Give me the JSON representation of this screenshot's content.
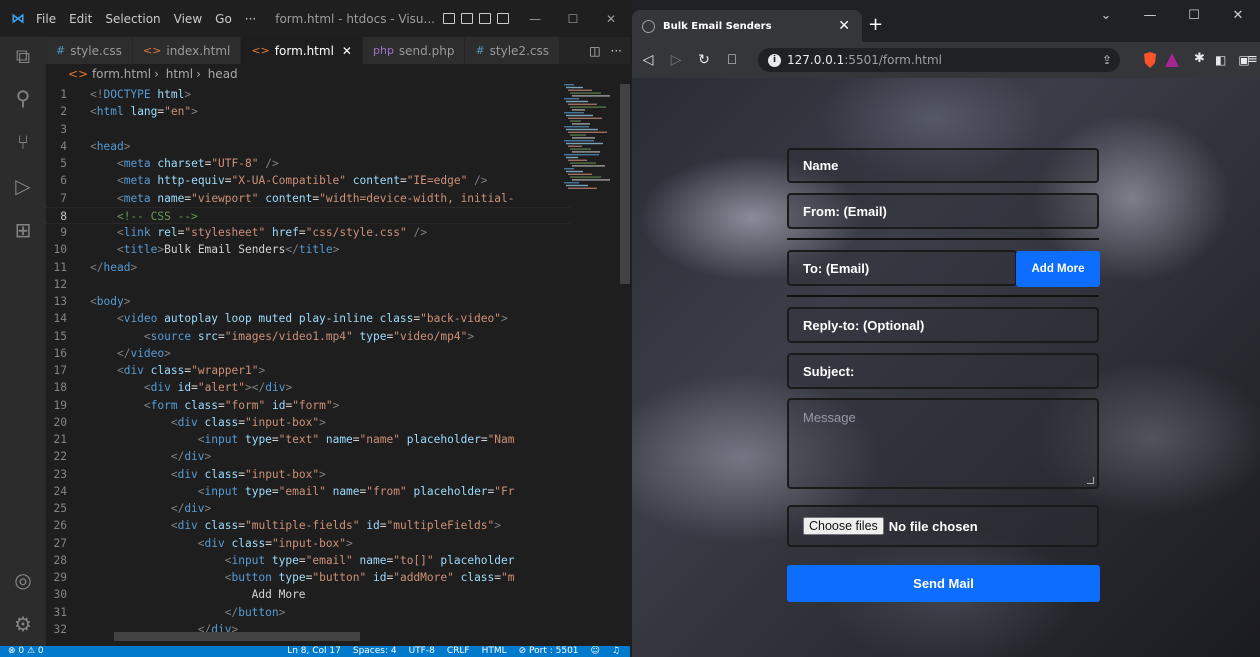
{
  "vscode": {
    "menu": [
      "File",
      "Edit",
      "Selection",
      "View",
      "Go",
      "···"
    ],
    "window_title": "form.html - htdocs - Visu...",
    "tabs": [
      {
        "label": "style.css",
        "icon": "#",
        "color": "#519aba"
      },
      {
        "label": "index.html",
        "icon": "<>",
        "color": "#e37933"
      },
      {
        "label": "form.html",
        "icon": "<>",
        "color": "#e37933",
        "active": true
      },
      {
        "label": "send.php",
        "icon": "php",
        "color": "#a074c4"
      },
      {
        "label": "style2.css",
        "icon": "#",
        "color": "#519aba"
      }
    ],
    "breadcrumb": [
      "form.html",
      "html",
      "head"
    ],
    "current_line": 8,
    "lines": [
      {
        "n": 1,
        "t": [
          [
            "punc",
            "<!"
          ],
          [
            "tag",
            "DOCTYPE"
          ],
          [
            "txt",
            " "
          ],
          [
            "attr",
            "html"
          ],
          [
            "punc",
            ">"
          ]
        ]
      },
      {
        "n": 2,
        "t": [
          [
            "punc",
            "<"
          ],
          [
            "tag",
            "html"
          ],
          [
            "txt",
            " "
          ],
          [
            "attr",
            "lang"
          ],
          [
            "txt",
            "="
          ],
          [
            "str",
            "\"en\""
          ],
          [
            "punc",
            ">"
          ]
        ]
      },
      {
        "n": 3,
        "t": []
      },
      {
        "n": 4,
        "t": [
          [
            "punc",
            "<"
          ],
          [
            "tag",
            "head"
          ],
          [
            "punc",
            ">"
          ]
        ]
      },
      {
        "n": 5,
        "t": [
          [
            "txt",
            "    "
          ],
          [
            "punc",
            "<"
          ],
          [
            "tag",
            "meta"
          ],
          [
            "txt",
            " "
          ],
          [
            "attr",
            "charset"
          ],
          [
            "txt",
            "="
          ],
          [
            "str",
            "\"UTF-8\""
          ],
          [
            "txt",
            " "
          ],
          [
            "punc",
            "/>"
          ]
        ]
      },
      {
        "n": 6,
        "t": [
          [
            "txt",
            "    "
          ],
          [
            "punc",
            "<"
          ],
          [
            "tag",
            "meta"
          ],
          [
            "txt",
            " "
          ],
          [
            "attr",
            "http-equiv"
          ],
          [
            "txt",
            "="
          ],
          [
            "str",
            "\"X-UA-Compatible\""
          ],
          [
            "txt",
            " "
          ],
          [
            "attr",
            "content"
          ],
          [
            "txt",
            "="
          ],
          [
            "str",
            "\"IE=edge\""
          ],
          [
            "txt",
            " "
          ],
          [
            "punc",
            "/>"
          ]
        ]
      },
      {
        "n": 7,
        "t": [
          [
            "txt",
            "    "
          ],
          [
            "punc",
            "<"
          ],
          [
            "tag",
            "meta"
          ],
          [
            "txt",
            " "
          ],
          [
            "attr",
            "name"
          ],
          [
            "txt",
            "="
          ],
          [
            "str",
            "\"viewport\""
          ],
          [
            "txt",
            " "
          ],
          [
            "attr",
            "content"
          ],
          [
            "txt",
            "="
          ],
          [
            "str",
            "\"width=device-width, initial-"
          ]
        ]
      },
      {
        "n": 8,
        "t": [
          [
            "txt",
            "    "
          ],
          [
            "cmt",
            "<!-- CSS -->"
          ]
        ]
      },
      {
        "n": 9,
        "t": [
          [
            "txt",
            "    "
          ],
          [
            "punc",
            "<"
          ],
          [
            "tag",
            "link"
          ],
          [
            "txt",
            " "
          ],
          [
            "attr",
            "rel"
          ],
          [
            "txt",
            "="
          ],
          [
            "str",
            "\"stylesheet\""
          ],
          [
            "txt",
            " "
          ],
          [
            "attr",
            "href"
          ],
          [
            "txt",
            "="
          ],
          [
            "str",
            "\"css/style.css\""
          ],
          [
            "txt",
            " "
          ],
          [
            "punc",
            "/>"
          ]
        ]
      },
      {
        "n": 10,
        "t": [
          [
            "txt",
            "    "
          ],
          [
            "punc",
            "<"
          ],
          [
            "tag",
            "title"
          ],
          [
            "punc",
            ">"
          ],
          [
            "txt",
            "Bulk Email Senders"
          ],
          [
            "punc",
            "</"
          ],
          [
            "tag",
            "title"
          ],
          [
            "punc",
            ">"
          ]
        ]
      },
      {
        "n": 11,
        "t": [
          [
            "punc",
            "</"
          ],
          [
            "tag",
            "head"
          ],
          [
            "punc",
            ">"
          ]
        ]
      },
      {
        "n": 12,
        "t": []
      },
      {
        "n": 13,
        "t": [
          [
            "punc",
            "<"
          ],
          [
            "tag",
            "body"
          ],
          [
            "punc",
            ">"
          ]
        ]
      },
      {
        "n": 14,
        "t": [
          [
            "txt",
            "    "
          ],
          [
            "punc",
            "<"
          ],
          [
            "tag",
            "video"
          ],
          [
            "txt",
            " "
          ],
          [
            "attr",
            "autoplay loop muted play-inline class"
          ],
          [
            "txt",
            "="
          ],
          [
            "str",
            "\"back-video\""
          ],
          [
            "punc",
            ">"
          ]
        ]
      },
      {
        "n": 15,
        "t": [
          [
            "txt",
            "        "
          ],
          [
            "punc",
            "<"
          ],
          [
            "tag",
            "source"
          ],
          [
            "txt",
            " "
          ],
          [
            "attr",
            "src"
          ],
          [
            "txt",
            "="
          ],
          [
            "str",
            "\"images/video1.mp4\""
          ],
          [
            "txt",
            " "
          ],
          [
            "attr",
            "type"
          ],
          [
            "txt",
            "="
          ],
          [
            "str",
            "\"video/mp4\""
          ],
          [
            "punc",
            ">"
          ]
        ]
      },
      {
        "n": 16,
        "t": [
          [
            "txt",
            "    "
          ],
          [
            "punc",
            "</"
          ],
          [
            "tag",
            "video"
          ],
          [
            "punc",
            ">"
          ]
        ]
      },
      {
        "n": 17,
        "t": [
          [
            "txt",
            "    "
          ],
          [
            "punc",
            "<"
          ],
          [
            "tag",
            "div"
          ],
          [
            "txt",
            " "
          ],
          [
            "attr",
            "class"
          ],
          [
            "txt",
            "="
          ],
          [
            "str",
            "\"wrapper1\""
          ],
          [
            "punc",
            ">"
          ]
        ]
      },
      {
        "n": 18,
        "t": [
          [
            "txt",
            "        "
          ],
          [
            "punc",
            "<"
          ],
          [
            "tag",
            "div"
          ],
          [
            "txt",
            " "
          ],
          [
            "attr",
            "id"
          ],
          [
            "txt",
            "="
          ],
          [
            "str",
            "\"alert\""
          ],
          [
            "punc",
            "></"
          ],
          [
            "tag",
            "div"
          ],
          [
            "punc",
            ">"
          ]
        ]
      },
      {
        "n": 19,
        "t": [
          [
            "txt",
            "        "
          ],
          [
            "punc",
            "<"
          ],
          [
            "tag",
            "form"
          ],
          [
            "txt",
            " "
          ],
          [
            "attr",
            "class"
          ],
          [
            "txt",
            "="
          ],
          [
            "str",
            "\"form\""
          ],
          [
            "txt",
            " "
          ],
          [
            "attr",
            "id"
          ],
          [
            "txt",
            "="
          ],
          [
            "str",
            "\"form\""
          ],
          [
            "punc",
            ">"
          ]
        ]
      },
      {
        "n": 20,
        "t": [
          [
            "txt",
            "            "
          ],
          [
            "punc",
            "<"
          ],
          [
            "tag",
            "div"
          ],
          [
            "txt",
            " "
          ],
          [
            "attr",
            "class"
          ],
          [
            "txt",
            "="
          ],
          [
            "str",
            "\"input-box\""
          ],
          [
            "punc",
            ">"
          ]
        ]
      },
      {
        "n": 21,
        "t": [
          [
            "txt",
            "                "
          ],
          [
            "punc",
            "<"
          ],
          [
            "tag",
            "input"
          ],
          [
            "txt",
            " "
          ],
          [
            "attr",
            "type"
          ],
          [
            "txt",
            "="
          ],
          [
            "str",
            "\"text\""
          ],
          [
            "txt",
            " "
          ],
          [
            "attr",
            "name"
          ],
          [
            "txt",
            "="
          ],
          [
            "str",
            "\"name\""
          ],
          [
            "txt",
            " "
          ],
          [
            "attr",
            "placeholder"
          ],
          [
            "txt",
            "="
          ],
          [
            "str",
            "\"Nam"
          ]
        ]
      },
      {
        "n": 22,
        "t": [
          [
            "txt",
            "            "
          ],
          [
            "punc",
            "</"
          ],
          [
            "tag",
            "div"
          ],
          [
            "punc",
            ">"
          ]
        ]
      },
      {
        "n": 23,
        "t": [
          [
            "txt",
            "            "
          ],
          [
            "punc",
            "<"
          ],
          [
            "tag",
            "div"
          ],
          [
            "txt",
            " "
          ],
          [
            "attr",
            "class"
          ],
          [
            "txt",
            "="
          ],
          [
            "str",
            "\"input-box\""
          ],
          [
            "punc",
            ">"
          ]
        ]
      },
      {
        "n": 24,
        "t": [
          [
            "txt",
            "                "
          ],
          [
            "punc",
            "<"
          ],
          [
            "tag",
            "input"
          ],
          [
            "txt",
            " "
          ],
          [
            "attr",
            "type"
          ],
          [
            "txt",
            "="
          ],
          [
            "str",
            "\"email\""
          ],
          [
            "txt",
            " "
          ],
          [
            "attr",
            "name"
          ],
          [
            "txt",
            "="
          ],
          [
            "str",
            "\"from\""
          ],
          [
            "txt",
            " "
          ],
          [
            "attr",
            "placeholder"
          ],
          [
            "txt",
            "="
          ],
          [
            "str",
            "\"Fr"
          ]
        ]
      },
      {
        "n": 25,
        "t": [
          [
            "txt",
            "            "
          ],
          [
            "punc",
            "</"
          ],
          [
            "tag",
            "div"
          ],
          [
            "punc",
            ">"
          ]
        ]
      },
      {
        "n": 26,
        "t": [
          [
            "txt",
            "            "
          ],
          [
            "punc",
            "<"
          ],
          [
            "tag",
            "div"
          ],
          [
            "txt",
            " "
          ],
          [
            "attr",
            "class"
          ],
          [
            "txt",
            "="
          ],
          [
            "str",
            "\"multiple-fields\""
          ],
          [
            "txt",
            " "
          ],
          [
            "attr",
            "id"
          ],
          [
            "txt",
            "="
          ],
          [
            "str",
            "\"multipleFields\""
          ],
          [
            "punc",
            ">"
          ]
        ]
      },
      {
        "n": 27,
        "t": [
          [
            "txt",
            "                "
          ],
          [
            "punc",
            "<"
          ],
          [
            "tag",
            "div"
          ],
          [
            "txt",
            " "
          ],
          [
            "attr",
            "class"
          ],
          [
            "txt",
            "="
          ],
          [
            "str",
            "\"input-box\""
          ],
          [
            "punc",
            ">"
          ]
        ]
      },
      {
        "n": 28,
        "t": [
          [
            "txt",
            "                    "
          ],
          [
            "punc",
            "<"
          ],
          [
            "tag",
            "input"
          ],
          [
            "txt",
            " "
          ],
          [
            "attr",
            "type"
          ],
          [
            "txt",
            "="
          ],
          [
            "str",
            "\"email\""
          ],
          [
            "txt",
            " "
          ],
          [
            "attr",
            "name"
          ],
          [
            "txt",
            "="
          ],
          [
            "str",
            "\"to[]\""
          ],
          [
            "txt",
            " "
          ],
          [
            "attr",
            "placeholder"
          ]
        ]
      },
      {
        "n": 29,
        "t": [
          [
            "txt",
            "                    "
          ],
          [
            "punc",
            "<"
          ],
          [
            "tag",
            "button"
          ],
          [
            "txt",
            " "
          ],
          [
            "attr",
            "type"
          ],
          [
            "txt",
            "="
          ],
          [
            "str",
            "\"button\""
          ],
          [
            "txt",
            " "
          ],
          [
            "attr",
            "id"
          ],
          [
            "txt",
            "="
          ],
          [
            "str",
            "\"addMore\""
          ],
          [
            "txt",
            " "
          ],
          [
            "attr",
            "class"
          ],
          [
            "txt",
            "="
          ],
          [
            "str",
            "\"m"
          ]
        ]
      },
      {
        "n": 30,
        "t": [
          [
            "txt",
            "                        Add More"
          ]
        ]
      },
      {
        "n": 31,
        "t": [
          [
            "txt",
            "                    "
          ],
          [
            "punc",
            "</"
          ],
          [
            "tag",
            "button"
          ],
          [
            "punc",
            ">"
          ]
        ]
      },
      {
        "n": 32,
        "t": [
          [
            "txt",
            "                "
          ],
          [
            "punc",
            "</"
          ],
          [
            "tag",
            "div"
          ],
          [
            "punc",
            ">"
          ]
        ]
      }
    ],
    "status_left": "⊗ 0  ⚠ 0",
    "status_right": [
      "Ln 8, Col 17",
      "Spaces: 4",
      "UTF-8",
      "CRLF",
      "HTML",
      "⊘ Port : 5501"
    ]
  },
  "browser": {
    "tab_title": "Bulk Email Senders",
    "url_host": "127.0.0.1",
    "url_path": ":5501/form.html",
    "form": {
      "name": "Name",
      "from": "From: (Email)",
      "to": "To: (Email)",
      "add_more": "Add More",
      "reply_to": "Reply-to: (Optional)",
      "subject": "Subject:",
      "message": "Message",
      "choose_files": "Choose files",
      "no_file": "No file chosen",
      "send": "Send Mail"
    }
  }
}
